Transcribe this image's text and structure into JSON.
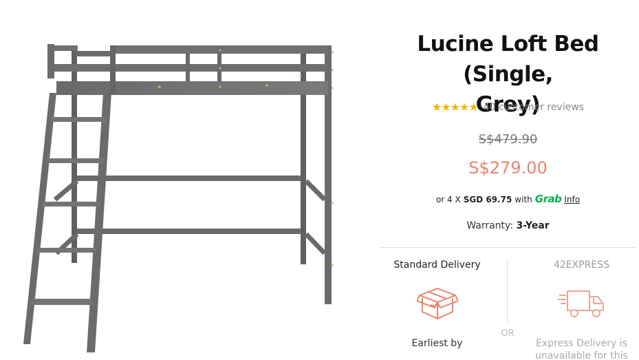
{
  "product": {
    "title_line1": "Lucine Loft Bed (Single,",
    "title_line2": "Grey)",
    "image_alt": "Grey wooden loft bed with ladder",
    "rating": {
      "stars": 5,
      "reviews_text": "40 customer reviews"
    },
    "price": {
      "original": "S$479.90",
      "sale": "S$279.00"
    },
    "installment": {
      "prefix": "or 4 X",
      "amount": "SGD 69.75",
      "with": "with",
      "provider": "Grab",
      "info_label": "Info"
    },
    "warranty": {
      "label": "Warranty:",
      "value": "3-Year"
    }
  },
  "delivery": {
    "standard": {
      "title": "Standard Delivery",
      "text": "Earliest by",
      "icon": "box-icon"
    },
    "separator": "OR",
    "express": {
      "title": "42EXPRESS",
      "text": "Express Delivery is unavailable for this",
      "icon": "delivery-truck-icon"
    }
  },
  "colors": {
    "accent_price": "#e8836a",
    "grab_green": "#00b14f",
    "star": "#f5b400",
    "bed_grey": "#6e6e6e"
  }
}
